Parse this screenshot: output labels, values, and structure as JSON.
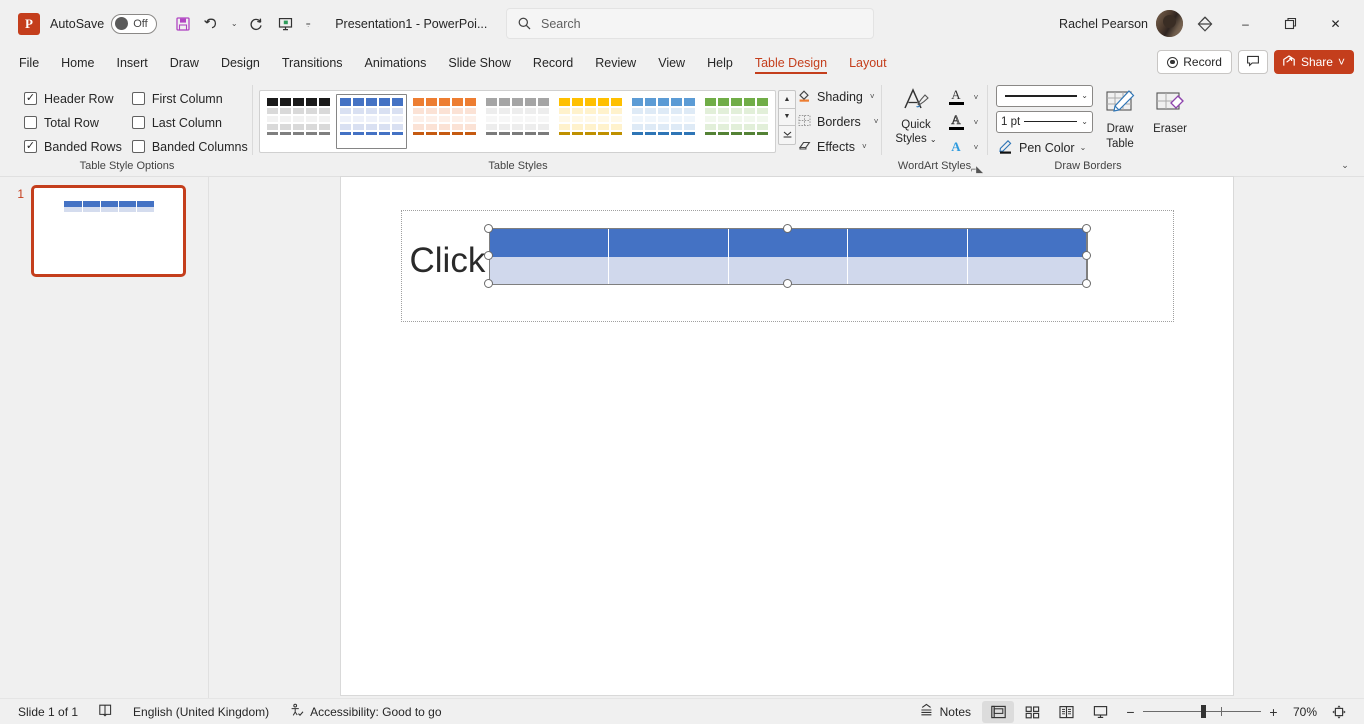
{
  "titlebar": {
    "app_icon": "powerpoint-logo",
    "autosave_label": "AutoSave",
    "autosave_state": "Off",
    "save_icon": "save-icon",
    "undo_icon": "undo-icon",
    "redo_icon": "redo-icon",
    "present_icon": "start-presentation-icon",
    "customize_icon": "customize-quick-access-toolbar-icon",
    "document_title": "Presentation1  -  PowerPoi...",
    "account_name": "Rachel Pearson",
    "diamond_icon": "microsoft-365-diamond-icon",
    "minimize": "–",
    "restore": "❐",
    "close": "✕"
  },
  "search": {
    "placeholder": "Search",
    "icon": "search-icon"
  },
  "tabs": [
    {
      "label": "File",
      "state": "normal"
    },
    {
      "label": "Home",
      "state": "normal"
    },
    {
      "label": "Insert",
      "state": "normal"
    },
    {
      "label": "Draw",
      "state": "normal"
    },
    {
      "label": "Design",
      "state": "normal"
    },
    {
      "label": "Transitions",
      "state": "normal"
    },
    {
      "label": "Animations",
      "state": "normal"
    },
    {
      "label": "Slide Show",
      "state": "normal"
    },
    {
      "label": "Record",
      "state": "normal"
    },
    {
      "label": "Review",
      "state": "normal"
    },
    {
      "label": "View",
      "state": "normal"
    },
    {
      "label": "Help",
      "state": "normal"
    },
    {
      "label": "Table Design",
      "state": "active"
    },
    {
      "label": "Layout",
      "state": "contextual"
    }
  ],
  "tabs_right": {
    "record_label": "Record",
    "comments_icon": "comments-icon",
    "share_label": "Share",
    "share_icon": "share-icon",
    "share_caret": "˅",
    "share_color": "#c43e1c"
  },
  "ribbon": {
    "collapse_icon": "collapse-ribbon-chevron-icon",
    "table_style_options": {
      "group_label": "Table Style Options",
      "checkboxes": [
        {
          "label": "Header Row",
          "checked": true
        },
        {
          "label": "First Column",
          "checked": false
        },
        {
          "label": "Total Row",
          "checked": false
        },
        {
          "label": "Last Column",
          "checked": false
        },
        {
          "label": "Banded Rows",
          "checked": true
        },
        {
          "label": "Banded Columns",
          "checked": false
        }
      ]
    },
    "table_styles": {
      "group_label": "Table Styles",
      "scroll_up_icon": "scroll-up-icon",
      "scroll_down_icon": "scroll-down-icon",
      "more_icon": "more-table-styles-icon",
      "swatches": [
        {
          "name": "no-style-table-grid",
          "header": "#1a1a1a",
          "band_a": "#d9d9d9",
          "band_b": "#f2f2f2",
          "line": "#7f7f7f",
          "selected": false
        },
        {
          "name": "themed-style-blue",
          "header": "#4472c4",
          "band_a": "#d9e0f2",
          "band_b": "#eef1fa",
          "line": "#4472c4",
          "selected": true
        },
        {
          "name": "themed-style-orange",
          "header": "#ed7d31",
          "band_a": "#fbe2d5",
          "band_b": "#fdf0e9",
          "line": "#c55a11",
          "selected": false
        },
        {
          "name": "themed-style-grey",
          "header": "#a5a5a5",
          "band_a": "#ededed",
          "band_b": "#f7f7f7",
          "line": "#7b7b7b",
          "selected": false
        },
        {
          "name": "themed-style-gold",
          "header": "#ffc000",
          "band_a": "#fff2cc",
          "band_b": "#fff9e8",
          "line": "#bf9000",
          "selected": false
        },
        {
          "name": "themed-style-light-blue",
          "header": "#5b9bd5",
          "band_a": "#deeaf6",
          "band_b": "#f0f6fc",
          "line": "#2e75b6",
          "selected": false
        },
        {
          "name": "themed-style-green",
          "header": "#70ad47",
          "band_a": "#e2efd9",
          "band_b": "#f2f8ee",
          "line": "#548235",
          "selected": false
        }
      ]
    },
    "shading_group": {
      "shading_label": "Shading",
      "shading_icon": "shading-bucket-icon",
      "borders_label": "Borders",
      "borders_icon": "borders-grid-icon",
      "effects_label": "Effects",
      "effects_icon": "effects-icon",
      "caret": "˅"
    },
    "wordart_styles": {
      "group_label": "WordArt Styles",
      "quick_styles_line1": "Quick",
      "quick_styles_line2": "Styles",
      "quick_styles_icon": "quick-styles-a-brush-icon",
      "text_fill_icon": "text-fill-icon",
      "text_outline_icon": "text-outline-icon",
      "text_effects_icon": "text-effects-icon",
      "text_fill_color": "#000000",
      "text_effects_color": "#2e75b6",
      "dialog_launcher_icon": "dialog-box-launcher-icon",
      "caret": "˅"
    },
    "draw_borders": {
      "group_label": "Draw Borders",
      "pen_style_value": "",
      "pen_weight_value": "1 pt",
      "pen_color_label": "Pen Color",
      "pen_color_icon": "pen-color-icon",
      "draw_table_line1": "Draw",
      "draw_table_line2": "Table",
      "draw_table_icon": "draw-table-icon",
      "eraser_label": "Eraser",
      "eraser_icon": "eraser-icon",
      "caret": "˅"
    }
  },
  "thumbnails": [
    {
      "number": "1",
      "selected": true,
      "border_color": "#c43e1c"
    }
  ],
  "slide": {
    "placeholder_text": "Click",
    "table": {
      "columns": 5,
      "rows": 2,
      "header_fill": "#4472c4",
      "body_fill": "#d0d8ec",
      "gridline_color": "#ffffff",
      "outline_color": "#7f7f7f",
      "selected": true,
      "handles": 8
    }
  },
  "status": {
    "slide_count": "Slide 1 of 1",
    "notes_page_icon": "notes-page-icon",
    "language": "English (United Kingdom)",
    "accessibility_icon": "accessibility-icon",
    "accessibility": "Accessibility: Good to go",
    "notes_label": "Notes",
    "notes_icon": "notes-icon",
    "views": [
      {
        "name": "normal-view",
        "icon": "normal-view-icon",
        "active": true
      },
      {
        "name": "slide-sorter-view",
        "icon": "slide-sorter-icon",
        "active": false
      },
      {
        "name": "reading-view",
        "icon": "reading-view-icon",
        "active": false
      },
      {
        "name": "slide-show-view",
        "icon": "slide-show-icon",
        "active": false
      }
    ],
    "zoom_out": "−",
    "zoom_in": "+",
    "zoom_level": "70%",
    "fit_icon": "fit-slide-to-window-icon"
  }
}
